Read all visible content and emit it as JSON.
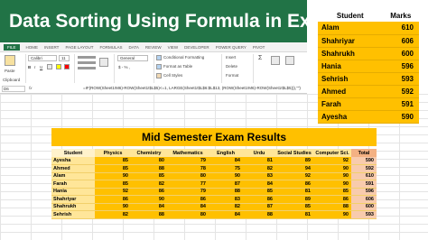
{
  "title": "Data Sorting Using Formula in Excel",
  "ribbon": {
    "tabs": [
      "FILE",
      "HOME",
      "INSERT",
      "PAGE LAYOUT",
      "FORMULAS",
      "DATA",
      "REVIEW",
      "VIEW",
      "DEVELOPER",
      "POWER QUERY",
      "PIVOT"
    ],
    "paste": "Paste",
    "clipboard": "Clipboard",
    "font_name": "Calibri",
    "font_size": "11",
    "number_format": "General",
    "conditional_formatting": "Conditional Formatting",
    "format_as_table": "Format as Table",
    "cell_styles": "Cell Styles",
    "insert": "Insert",
    "delete": "Delete",
    "format": "Format"
  },
  "formula_bar": {
    "name_box": "D6",
    "fx": "fx",
    "formula": "=IF(ROW(Sheet1!M6)-ROW(Sheet1!$L$5)<=1, LARGE(Sheet1!$L$6:$L$13, (ROW(Sheet1!M6)-ROW(Sheet1!$L$5))),\"\")"
  },
  "side_table": {
    "headers": [
      "Student",
      "Marks"
    ],
    "rows": [
      [
        "Alam",
        "610"
      ],
      [
        "Shahriyar",
        "606"
      ],
      [
        "Shahrukh",
        "600"
      ],
      [
        "Hania",
        "596"
      ],
      [
        "Sehrish",
        "593"
      ],
      [
        "Ahmed",
        "592"
      ],
      [
        "Farah",
        "591"
      ],
      [
        "Ayesha",
        "590"
      ]
    ]
  },
  "results": {
    "title": "Mid Semester Exam Results",
    "headers": [
      "Student",
      "Physics",
      "Chemistry",
      "Mathematics",
      "English",
      "Urdu",
      "Social Studies",
      "Computer Sci.",
      "Total"
    ],
    "rows": [
      [
        "Ayesha",
        "85",
        "80",
        "79",
        "84",
        "81",
        "89",
        "92",
        "590"
      ],
      [
        "Ahmed",
        "85",
        "88",
        "78",
        "75",
        "82",
        "94",
        "90",
        "592"
      ],
      [
        "Alam",
        "90",
        "85",
        "80",
        "90",
        "83",
        "92",
        "90",
        "610"
      ],
      [
        "Farah",
        "85",
        "82",
        "77",
        "87",
        "84",
        "86",
        "90",
        "591"
      ],
      [
        "Hania",
        "92",
        "86",
        "79",
        "88",
        "85",
        "81",
        "85",
        "596"
      ],
      [
        "Shahriyar",
        "86",
        "90",
        "86",
        "83",
        "86",
        "89",
        "86",
        "606"
      ],
      [
        "Shahrukh",
        "90",
        "84",
        "84",
        "82",
        "87",
        "85",
        "88",
        "600"
      ],
      [
        "Sehrish",
        "82",
        "88",
        "80",
        "84",
        "88",
        "81",
        "90",
        "593"
      ]
    ]
  }
}
